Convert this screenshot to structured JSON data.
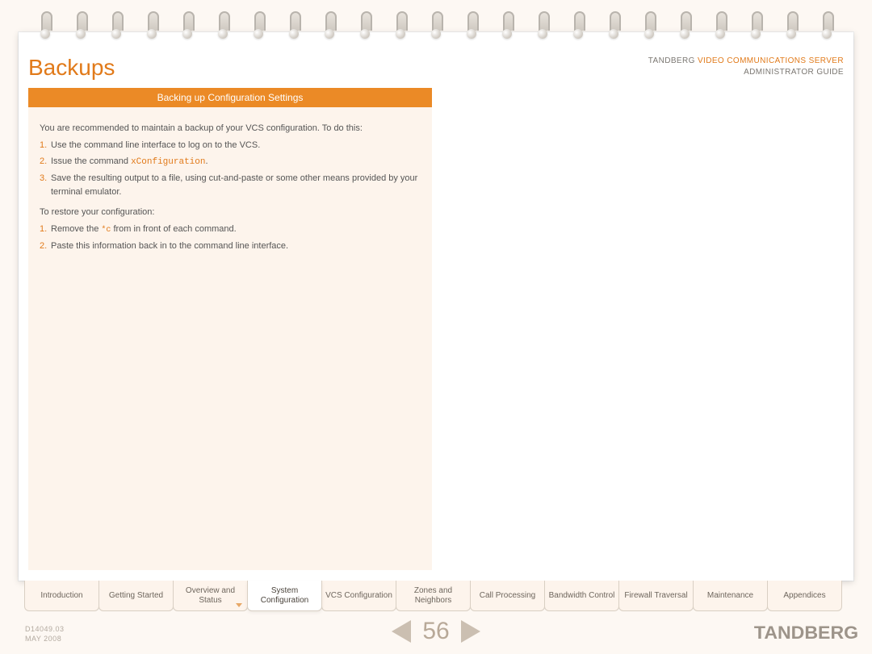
{
  "header": {
    "title": "Backups",
    "brand": "TANDBERG",
    "product": "VIDEO COMMUNICATIONS SERVER",
    "subtitle": "ADMINISTRATOR GUIDE"
  },
  "section": {
    "title": "Backing up Configuration Settings"
  },
  "body": {
    "intro": "You are recommended to maintain a backup of your VCS configuration. To do this:",
    "steps1": [
      "Use the command line interface to log on to the VCS.",
      "Issue the command ",
      "Save the resulting output to a file, using cut-and-paste or some other means provided by your terminal emulator."
    ],
    "cmd1": "xConfiguration",
    "restore_intro": "To restore your configuration:",
    "steps2_pre": "Remove the ",
    "steps2_code": "*c",
    "steps2_post": " from in front of each command.",
    "steps2_2": "Paste this information back in to the command line interface."
  },
  "tabs": [
    "Introduction",
    "Getting Started",
    "Overview and Status",
    "System Configuration",
    "VCS Configuration",
    "Zones and Neighbors",
    "Call Processing",
    "Bandwidth Control",
    "Firewall Traversal",
    "Maintenance",
    "Appendices"
  ],
  "active_tab_index": 3,
  "footer": {
    "docid": "D14049.03",
    "date": "MAY 2008",
    "page": "56",
    "logo": "TANDBERG"
  }
}
